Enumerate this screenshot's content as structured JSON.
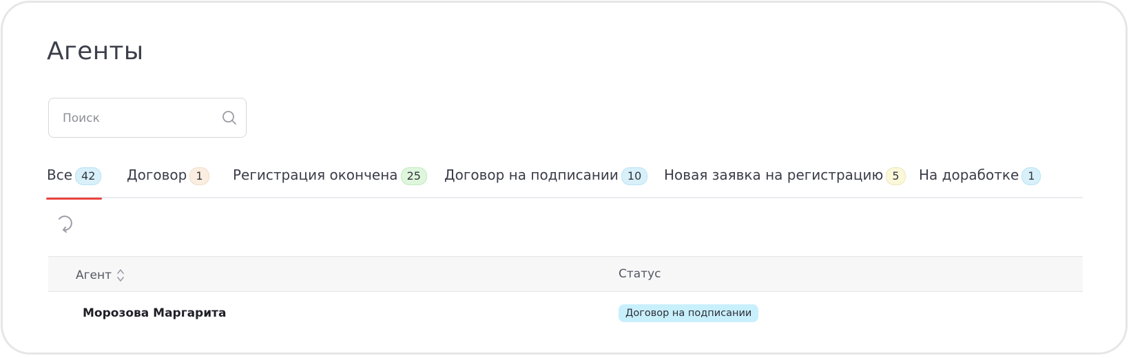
{
  "page": {
    "title": "Агенты"
  },
  "search": {
    "placeholder": "Поиск"
  },
  "tabs": [
    {
      "label": "Все",
      "count": "42",
      "color": "#d8f0fa",
      "border": "#b9e3f4"
    },
    {
      "label": "Договор",
      "count": "1",
      "color": "#fbeee0",
      "border": "#eeddcb"
    },
    {
      "label": "Регистрация окончена",
      "count": "25",
      "color": "#def6dc",
      "border": "#c2e9bf"
    },
    {
      "label": "Договор на подписании",
      "count": "10",
      "color": "#d8f0fa",
      "border": "#b9e3f4"
    },
    {
      "label": "Новая заявка на регистрацию",
      "count": "5",
      "color": "#fbf8d9",
      "border": "#ece6b8"
    },
    {
      "label": "На доработке",
      "count": "1",
      "color": "#d8f0fa",
      "border": "#b9e3f4"
    }
  ],
  "active_tab": "Все",
  "table": {
    "columns": [
      "Агент",
      "Статус"
    ],
    "rows": [
      {
        "agent": "Морозова Маргарита",
        "status": "Договор на подписании",
        "status_color": "#c8effc"
      }
    ]
  },
  "colors": {
    "accent": "#e8433c"
  },
  "icons": {
    "search": "search-icon",
    "refresh": "refresh-icon",
    "sort": "sort-icon"
  }
}
